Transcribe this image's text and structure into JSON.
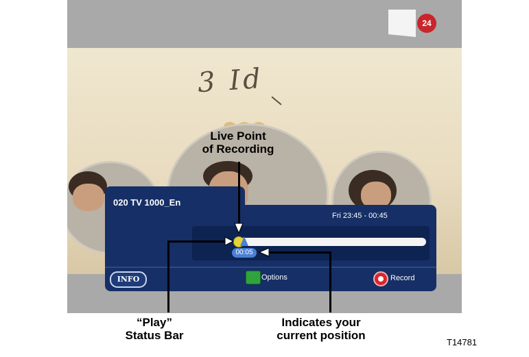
{
  "screen": {
    "channel_name": "020 TV 1000_En",
    "time_range": "Fri 23:45 - 00:45",
    "current_position": "00:05",
    "logo_badge": "24",
    "handwriting": "3 Id",
    "playback_progress": 0.02
  },
  "buttons": {
    "info_label": "INFO",
    "options_label": "Options",
    "record_label": "Record"
  },
  "callouts": {
    "live_point": [
      "Live Point",
      "of Recording"
    ],
    "play_status": [
      "“Play”",
      "Status Bar"
    ],
    "position": [
      "Indicates your",
      "current position"
    ]
  },
  "figure_code": "T14781",
  "colors": {
    "panel": "#162f66",
    "options_key": "#2fa43c",
    "record_key": "#d8262c",
    "position_marker": "#4a80d6",
    "live_dot": "#e7d23a"
  },
  "icons": [
    "green-options-key-icon",
    "red-record-key-icon",
    "live-point-icon",
    "position-marker-icon"
  ]
}
